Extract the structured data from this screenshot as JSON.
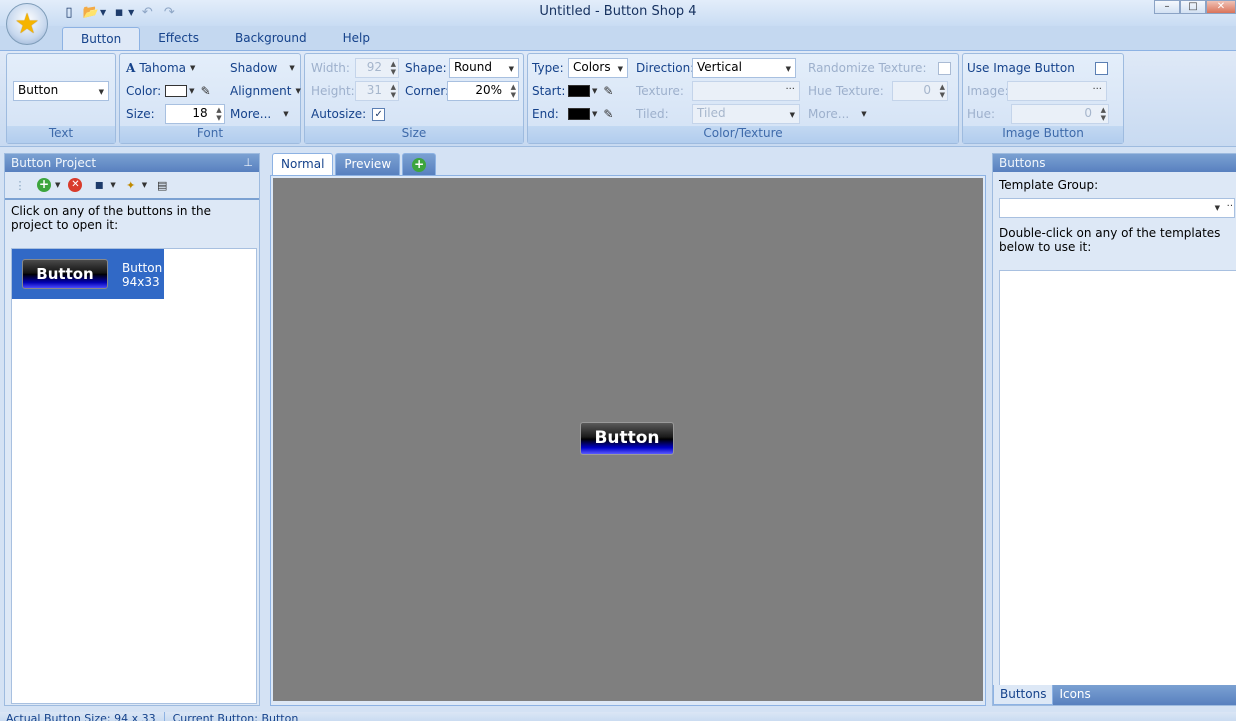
{
  "window": {
    "title": "Untitled - Button Shop 4"
  },
  "ribbon_tabs": [
    "Button",
    "Effects",
    "Background",
    "Help"
  ],
  "ribbon": {
    "text_group": {
      "label": "Text",
      "value": "Button"
    },
    "font_group": {
      "label": "Font",
      "font_name": "Tahoma",
      "shadow": "Shadow",
      "color_label": "Color:",
      "alignment": "Alignment",
      "size_label": "Size:",
      "size_value": "18",
      "more": "More..."
    },
    "size_group": {
      "label": "Size",
      "width_label": "Width:",
      "width_value": "92",
      "height_label": "Height:",
      "height_value": "31",
      "autosize_label": "Autosize:",
      "shape_label": "Shape:",
      "shape_value": "Round",
      "corner_label": "Corner:",
      "corner_value": "20%"
    },
    "color_group": {
      "label": "Color/Texture",
      "type_label": "Type:",
      "type_value": "Colors",
      "start_label": "Start:",
      "end_label": "End:",
      "direction_label": "Direction:",
      "direction_value": "Vertical",
      "texture_label": "Texture:",
      "tiled_label": "Tiled:",
      "tiled_value": "Tiled",
      "randomize_label": "Randomize Texture:",
      "hue_texture_label": "Hue Texture:",
      "hue_texture_value": "0",
      "more": "More..."
    },
    "image_group": {
      "label": "Image Button",
      "use_image_label": "Use Image Button",
      "image_label": "Image:",
      "hue_label": "Hue:",
      "hue_value": "0"
    }
  },
  "left_panel": {
    "title": "Button Project",
    "description": "Click on any of the buttons in the project to open it:",
    "item": {
      "button_text": "Button",
      "name": "Button",
      "size": "94x33"
    }
  },
  "center": {
    "tabs": [
      "Normal",
      "Preview"
    ],
    "preview_button_text": "Button"
  },
  "right_panel": {
    "title": "Buttons",
    "template_group_label": "Template Group:",
    "description": "Double-click on any of the templates below to use it:",
    "tabs": [
      "Buttons",
      "Icons"
    ]
  },
  "statusbar": {
    "actual_size": "Actual Button Size: 94 x 33",
    "current": "Current Button: Button"
  },
  "colors": {
    "start_color": "#000000",
    "end_color": "#000000",
    "font_color": "#ffffff",
    "canvas_bg": "#7f7f7f",
    "selection": "#3169c6"
  }
}
